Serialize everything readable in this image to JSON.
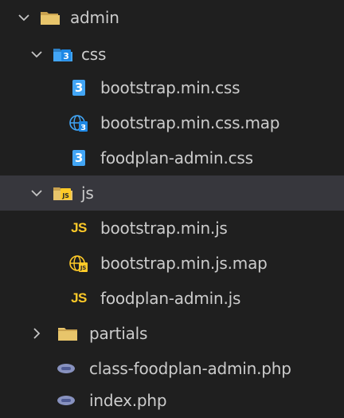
{
  "tree": {
    "root": {
      "label": "admin",
      "expanded": true,
      "icon": "folder-open-icon"
    },
    "css_folder": {
      "label": "css",
      "expanded": true,
      "icon": "css-folder-open-icon"
    },
    "css_files": [
      {
        "label": "bootstrap.min.css",
        "icon": "css-file-icon"
      },
      {
        "label": "bootstrap.min.css.map",
        "icon": "css-map-file-icon"
      },
      {
        "label": "foodplan-admin.css",
        "icon": "css-file-icon"
      }
    ],
    "js_folder": {
      "label": "js",
      "expanded": true,
      "selected": true,
      "icon": "js-folder-open-icon"
    },
    "js_files": [
      {
        "label": "bootstrap.min.js",
        "icon": "js-file-icon",
        "badge": "JS"
      },
      {
        "label": "bootstrap.min.js.map",
        "icon": "js-map-file-icon"
      },
      {
        "label": "foodplan-admin.js",
        "icon": "js-file-icon",
        "badge": "JS"
      }
    ],
    "partials_folder": {
      "label": "partials",
      "expanded": false,
      "icon": "folder-closed-icon"
    },
    "php_files": [
      {
        "label": "class-foodplan-admin.php",
        "icon": "php-file-icon"
      },
      {
        "label": "index.php",
        "icon": "php-file-icon"
      }
    ]
  },
  "colors": {
    "background": "#1f1f1f",
    "selected_row": "#37373d",
    "text": "#cccccc",
    "folder": "#e8c56b",
    "css_blue": "#42a5f5",
    "js_yellow": "#ffca28",
    "php_purple": "#8892bf"
  }
}
